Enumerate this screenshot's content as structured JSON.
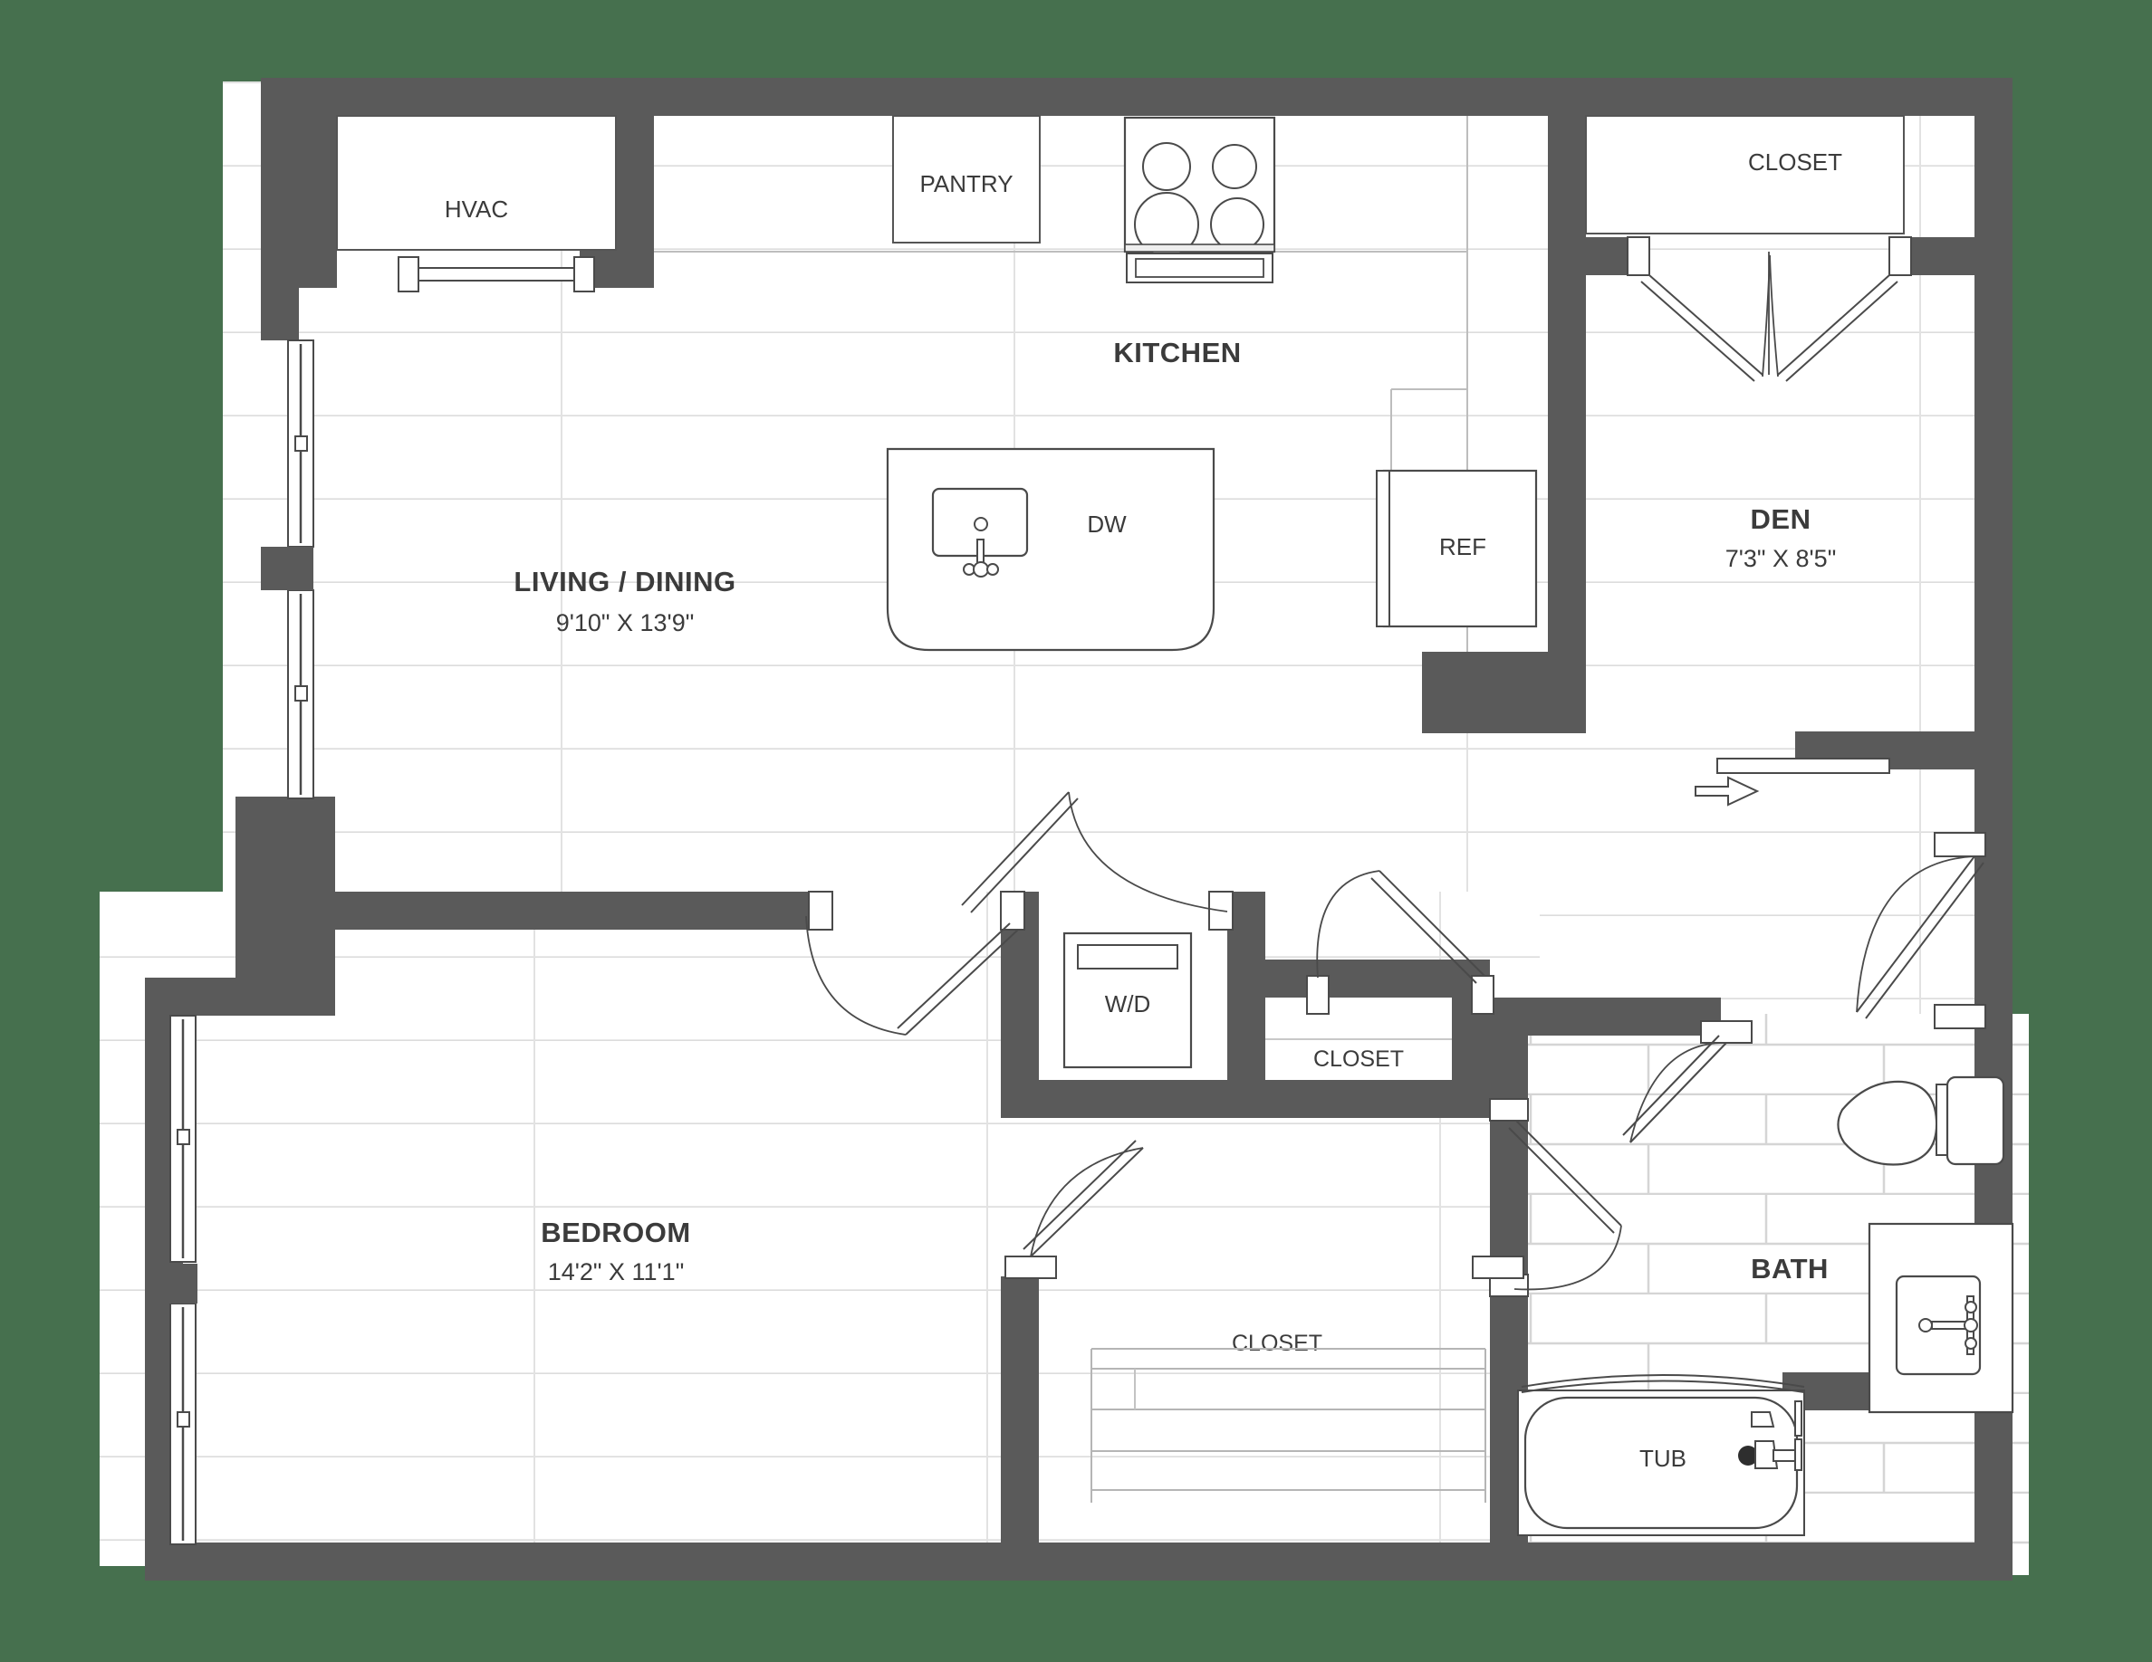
{
  "plan": {
    "title": "Apartment Floor Plan",
    "background_color": "#46704e",
    "wall_color": "#5a5a5a",
    "floor_color": "#ffffff",
    "floor_line_color": "#d8d8d8",
    "fixture_line_color": "#4a4a4a",
    "text_color": "#3b3b3b"
  },
  "rooms": [
    {
      "id": "living_dining",
      "name": "LIVING / DINING",
      "dimensions": "9'10\" X 13'9\""
    },
    {
      "id": "kitchen",
      "name": "KITCHEN",
      "dimensions": ""
    },
    {
      "id": "den",
      "name": "DEN",
      "dimensions": "7'3\" X 8'5\""
    },
    {
      "id": "bedroom",
      "name": "BEDROOM",
      "dimensions": "14'2\" X 11'1\""
    },
    {
      "id": "bath",
      "name": "BATH",
      "dimensions": ""
    }
  ],
  "labels": {
    "hvac": "HVAC",
    "pantry": "PANTRY",
    "dishwasher": "DW",
    "refrigerator": "REF",
    "washer_dryer": "W/D",
    "tub": "TUB",
    "closet_den": "CLOSET",
    "closet_hall": "CLOSET",
    "closet_bedroom": "CLOSET"
  },
  "fixtures": [
    {
      "name": "range",
      "burners": 4
    },
    {
      "name": "kitchen-island-sink",
      "basins": 1,
      "faucet": true
    },
    {
      "name": "dishwasher",
      "label": "DW"
    },
    {
      "name": "refrigerator",
      "label": "REF"
    },
    {
      "name": "pantry",
      "label": "PANTRY"
    },
    {
      "name": "washer-dryer",
      "label": "W/D"
    },
    {
      "name": "toilet"
    },
    {
      "name": "vanity-sink",
      "faucet": true
    },
    {
      "name": "bathtub",
      "label": "TUB"
    },
    {
      "name": "hvac-unit",
      "label": "HVAC"
    }
  ],
  "doors": [
    {
      "name": "hvac-bifold-door",
      "type": "bifold"
    },
    {
      "name": "den-closet-double-door",
      "type": "double-swing"
    },
    {
      "name": "entry-door",
      "type": "swing"
    },
    {
      "name": "den-sliding-door",
      "type": "sliding",
      "arrow": true
    },
    {
      "name": "bedroom-door",
      "type": "swing"
    },
    {
      "name": "laundry-door",
      "type": "swing"
    },
    {
      "name": "hall-closet-door",
      "type": "swing"
    },
    {
      "name": "bath-door",
      "type": "swing"
    },
    {
      "name": "bedroom-closet-door",
      "type": "swing"
    }
  ],
  "windows": [
    {
      "name": "living-window-upper"
    },
    {
      "name": "living-window-lower"
    },
    {
      "name": "bedroom-window-upper"
    },
    {
      "name": "bedroom-window-lower"
    }
  ]
}
